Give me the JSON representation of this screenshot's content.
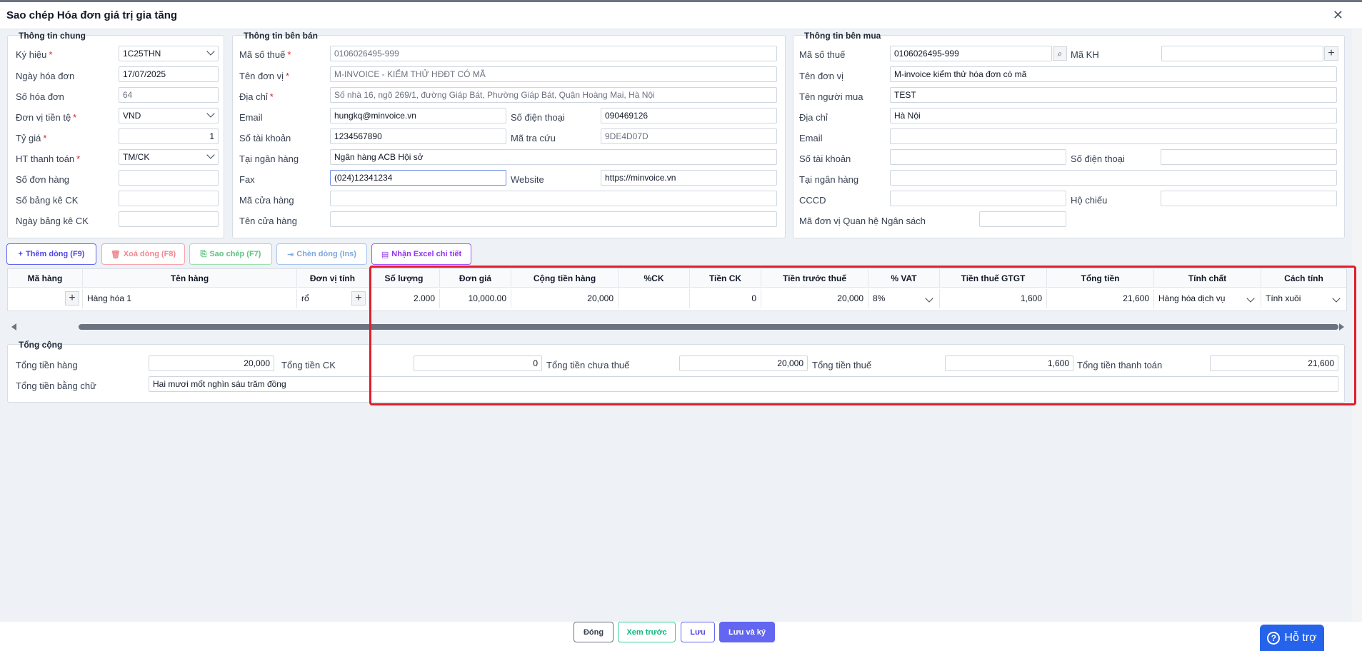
{
  "dialog": {
    "title": "Sao chép Hóa đơn giá trị gia tăng",
    "close": "✕"
  },
  "general": {
    "section_title": "Thông tin chung",
    "fields": [
      {
        "label": "Ký hiệu",
        "required": "*",
        "value": "1C25THN"
      },
      {
        "label": "Ngày hóa đơn",
        "value": "17/07/2025"
      },
      {
        "label": "Số hóa đơn",
        "value": "64"
      },
      {
        "label": "Đơn vị tiền tệ",
        "required": "*",
        "value": "VND"
      },
      {
        "label": "Tỷ giá",
        "required": "*",
        "value": "1"
      },
      {
        "label": "HT thanh toán",
        "required": "*",
        "value": "TM/CK"
      },
      {
        "label": "Số đơn hàng",
        "value": ""
      },
      {
        "label": "Số bảng kê CK",
        "value": ""
      },
      {
        "label": "Ngày bảng kê CK",
        "value": ""
      }
    ]
  },
  "seller": {
    "section_title": "Thông tin bên bán",
    "tax_code": {
      "label": "Mã số thuế",
      "required": "*",
      "value": "0106026495-999"
    },
    "name": {
      "label": "Tên đơn vị",
      "required": "*",
      "value": "M-INVOICE - KIỂM THỬ HĐĐT CÓ MÃ"
    },
    "address": {
      "label": "Địa chỉ",
      "required": "*",
      "value": "Số nhà 16, ngõ 269/1, đường Giáp Bát, Phường Giáp Bát, Quận Hoàng Mai, Hà Nội"
    },
    "email": {
      "label": "Email",
      "value": "hungkq@minvoice.vn"
    },
    "phone": {
      "label": "Số điện thoại",
      "value": "090469126"
    },
    "account": {
      "label": "Số tài khoản",
      "value": "1234567890"
    },
    "lookup": {
      "label": "Mã tra cứu",
      "value": "9DE4D07D"
    },
    "bank": {
      "label": "Tại ngân hàng",
      "value": "Ngân hàng ACB Hội sở"
    },
    "fax": {
      "label": "Fax",
      "value": "(024)12341234"
    },
    "website": {
      "label": "Website",
      "value": "https://minvoice.vn"
    },
    "store_code": {
      "label": "Mã cửa hàng",
      "value": ""
    },
    "store_name": {
      "label": "Tên cửa hàng",
      "value": ""
    }
  },
  "buyer": {
    "section_title": "Thông tin bên mua",
    "tax_code": {
      "label": "Mã số thuế",
      "value": "0106026495-999"
    },
    "customer_code": {
      "label": "Mã KH",
      "value": ""
    },
    "name": {
      "label": "Tên đơn vị",
      "value": "M-invoice kiểm thử hóa đơn có mã"
    },
    "buyer_name": {
      "label": "Tên người mua",
      "value": "TEST"
    },
    "address": {
      "label": "Địa chỉ",
      "value": "Hà Nội"
    },
    "email": {
      "label": "Email",
      "value": ""
    },
    "account": {
      "label": "Số tài khoản",
      "value": ""
    },
    "phone": {
      "label": "Số điện thoại",
      "value": ""
    },
    "bank": {
      "label": "Tại ngân hàng",
      "value": ""
    },
    "cccd": {
      "label": "CCCD",
      "value": ""
    },
    "passport": {
      "label": "Hộ chiếu",
      "value": ""
    },
    "budget_unit": {
      "label": "Mã đơn vị Quan hệ Ngân sách",
      "value": ""
    }
  },
  "toolbar": {
    "add": "Thêm dòng (F9)",
    "delete": "Xoá dòng (F8)",
    "copy": "Sao chép (F7)",
    "insert": "Chèn dòng (Ins)",
    "excel": "Nhận Excel chi tiết"
  },
  "grid": {
    "headers": [
      "Mã hàng",
      "Tên hàng",
      "Đơn vị tính",
      "Số lượng",
      "Đơn giá",
      "Cộng tiền hàng",
      "%CK",
      "Tiền CK",
      "Tiền trước thuế",
      "% VAT",
      "Tiền thuế GTGT",
      "Tổng tiền",
      "Tính chất",
      "Cách tính"
    ],
    "rows": [
      {
        "code": "",
        "name": "Hàng hóa 1",
        "unit": "rổ",
        "qty": "2.000",
        "price": "10,000.00",
        "amount": "20,000",
        "discount_pct": "",
        "discount": "0",
        "pre_tax": "20,000",
        "vat": "8%",
        "vat_amount": "1,600",
        "total": "21,600",
        "nature": "Hàng hóa dịch vụ",
        "method": "Tính xuôi"
      }
    ]
  },
  "totals": {
    "section_title": "Tổng cộng",
    "goods": {
      "label": "Tổng tiền hàng",
      "value": "20,000"
    },
    "discount": {
      "label": "Tổng tiền CK",
      "value": "0"
    },
    "pre_tax": {
      "label": "Tổng tiền chưa thuế",
      "value": "20,000"
    },
    "tax": {
      "label": "Tổng tiền thuế",
      "value": "1,600"
    },
    "payment": {
      "label": "Tổng tiền thanh toán",
      "value": "21,600"
    },
    "in_words": {
      "label": "Tổng tiền bằng chữ",
      "value": "Hai mươi mốt nghìn sáu trăm đồng"
    }
  },
  "footer": {
    "close": "Đóng",
    "preview": "Xem trước",
    "save": "Lưu",
    "save_sign": "Lưu và ký",
    "help": "Hỗ trợ"
  },
  "colors": {
    "highlight": "#e11d2a",
    "primary": "#6366f1",
    "help": "#2563eb"
  }
}
